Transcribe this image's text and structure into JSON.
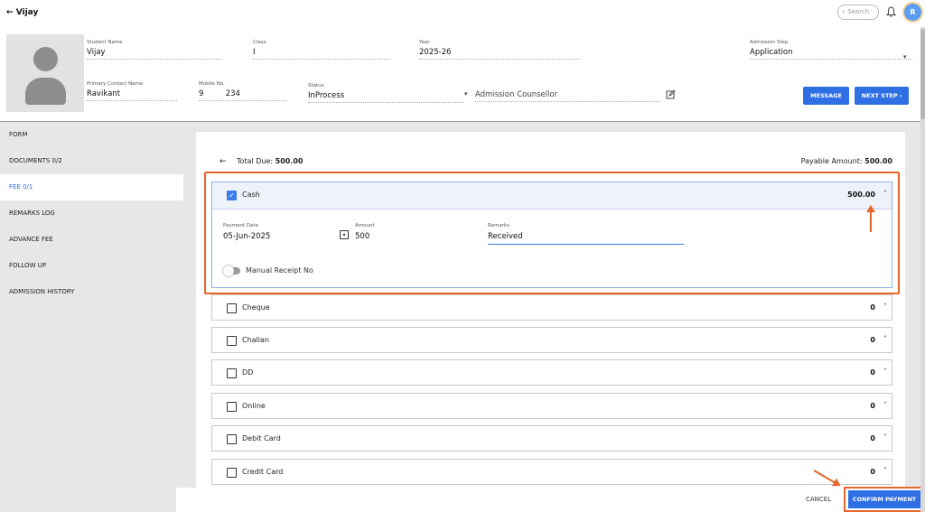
{
  "app": {
    "title": "Vijay",
    "back_arrow": "←"
  },
  "topbar": {
    "search_placeholder": "Search",
    "avatar_letter": "R"
  },
  "student": {
    "name_label": "Student Name",
    "name": "Vijay",
    "class_label": "Class",
    "class": "I",
    "year_label": "Year",
    "year": "2025-26",
    "step_label": "Admission Step",
    "step": "Application",
    "contact_label": "Primary Contact Name",
    "contact": "Ravikant",
    "mobile_label": "Mobile No.",
    "mobile": "9         234",
    "status_label": "Status",
    "status": "InProcess",
    "counsellor": "Admission Counsellor"
  },
  "buttons": {
    "message": "MESSAGE",
    "next_step": "NEXT STEP ›",
    "cancel": "CANCEL",
    "confirm": "CONFIRM PAYMENT"
  },
  "sidebar": {
    "items": [
      {
        "label": "FORM"
      },
      {
        "label": "DOCUMENTS 0/2"
      },
      {
        "label": "FEE 0/1",
        "active": true
      },
      {
        "label": "REMARKS LOG"
      },
      {
        "label": "ADVANCE FEE"
      },
      {
        "label": "FOLLOW UP"
      },
      {
        "label": "ADMISSION HISTORY"
      }
    ]
  },
  "fee": {
    "total_due_label": "Total Due: ",
    "total_due": "500.00",
    "payable_label": "Payable Amount: ",
    "payable": "500.00",
    "cash": {
      "label": "Cash",
      "amount": "500.00",
      "checked": true,
      "payment_date_label": "Payment Date",
      "payment_date": "05-Jun-2025",
      "amount_label": "Amount",
      "amount_value": "500",
      "remarks_label": "Remarks",
      "remarks": "Received",
      "manual_receipt_label": "Manual Receipt No"
    },
    "methods": [
      {
        "label": "Cheque",
        "amount": "0"
      },
      {
        "label": "Challan",
        "amount": "0"
      },
      {
        "label": "DD",
        "amount": "0"
      },
      {
        "label": "Online",
        "amount": "0"
      },
      {
        "label": "Debit Card",
        "amount": "0"
      },
      {
        "label": "Credit Card",
        "amount": "0"
      }
    ]
  },
  "colors": {
    "accent": "#2f6fe4",
    "highlight": "#e8652a"
  }
}
